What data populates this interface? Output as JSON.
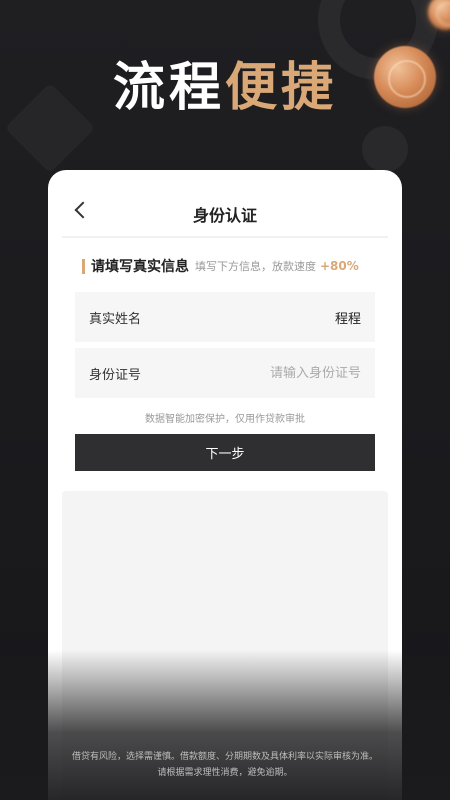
{
  "headline": {
    "white": "流程",
    "gold": "便捷"
  },
  "nav": {
    "title": "身份认证",
    "back_icon": "chevron-left-icon"
  },
  "section": {
    "title": "请填写真实信息",
    "subtitle": "填写下方信息，放款速度",
    "boost": "+80%"
  },
  "form": {
    "name_label": "真实姓名",
    "name_value": "程程",
    "id_label": "身份证号",
    "id_placeholder": "请输入身份证号",
    "id_value": ""
  },
  "note": "数据智能加密保护，仅用作贷款审批",
  "next_button": "下一步",
  "disclaimer": {
    "line1": "借贷有风险，选择需谨慎。借款额度、分期期数及具体利率以实际审核为准。",
    "line2": "请根据需求理性消费，避免逾期。"
  },
  "colors": {
    "accent": "#d9a876",
    "background": "#1b1b1d",
    "button": "#2f2f31"
  }
}
